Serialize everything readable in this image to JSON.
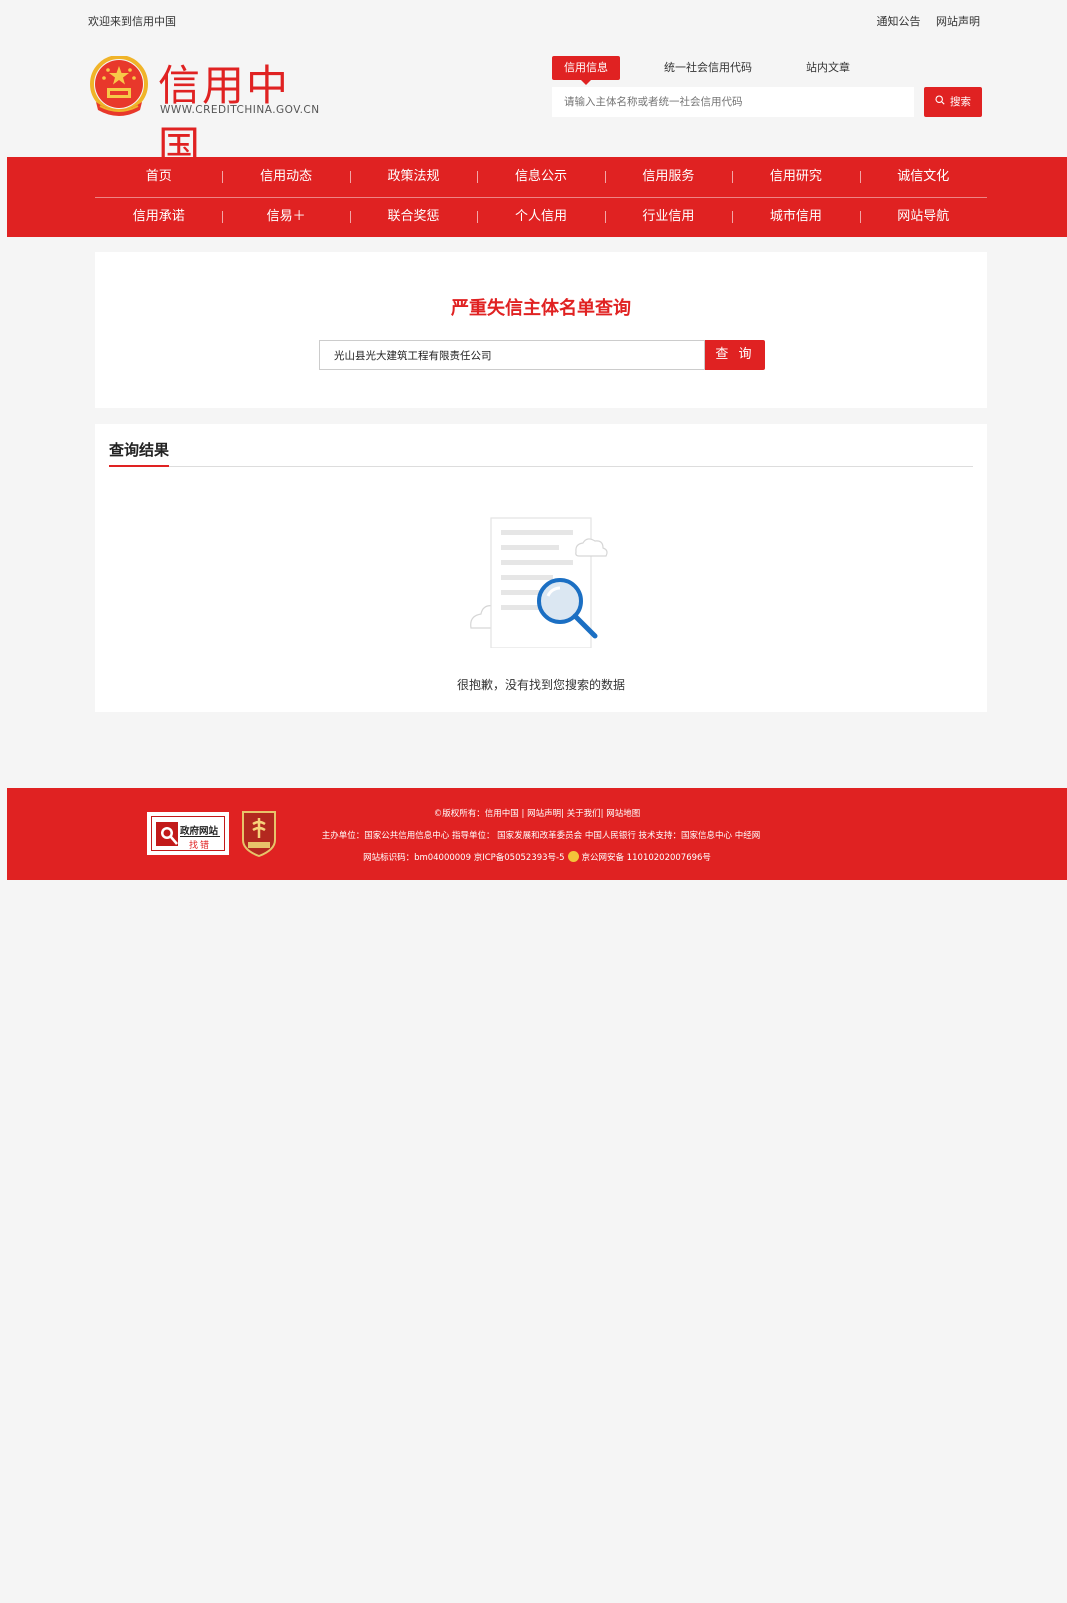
{
  "topbar": {
    "welcome": "欢迎来到信用中国",
    "links": [
      "通知公告",
      "网站声明"
    ]
  },
  "header": {
    "logo_title": "信用中国",
    "logo_subtitle": "WWW.CREDITCHINA.GOV.CN",
    "search_tabs": [
      {
        "label": "信用信息",
        "active": true
      },
      {
        "label": "统一社会信用代码",
        "active": false
      },
      {
        "label": "站内文章",
        "active": false
      }
    ],
    "search_placeholder": "请输入主体名称或者统一社会信用代码",
    "search_button": "搜索"
  },
  "nav": {
    "row1": [
      "首页",
      "信用动态",
      "政策法规",
      "信息公示",
      "信用服务",
      "信用研究",
      "诚信文化"
    ],
    "row2": [
      "信用承诺",
      "信易＋",
      "联合奖惩",
      "个人信用",
      "行业信用",
      "城市信用",
      "网站导航"
    ]
  },
  "query": {
    "title": "严重失信主体名单查询",
    "input_value": "光山县光大建筑工程有限责任公司",
    "button": "查 询"
  },
  "results": {
    "title": "查询结果",
    "empty_message": "很抱歉，没有找到您搜索的数据"
  },
  "footer": {
    "badge_title": "政府网站",
    "badge_sub": "找错",
    "copyright": "©版权所有：信用中国 | 网站声明| 关于我们| 网站地图",
    "organizers": "主办单位：国家公共信用信息中心   指导单位： 国家发展和改革委员会 中国人民银行   技术支持：国家信息中心 中经网",
    "icp_prefix": "网站标识码：bm04000009 京ICP备05052393号-5",
    "icp_suffix": "京公网安备 11010202007696号"
  },
  "colors": {
    "brand_red": "#e02222",
    "background": "#f5f5f5"
  }
}
